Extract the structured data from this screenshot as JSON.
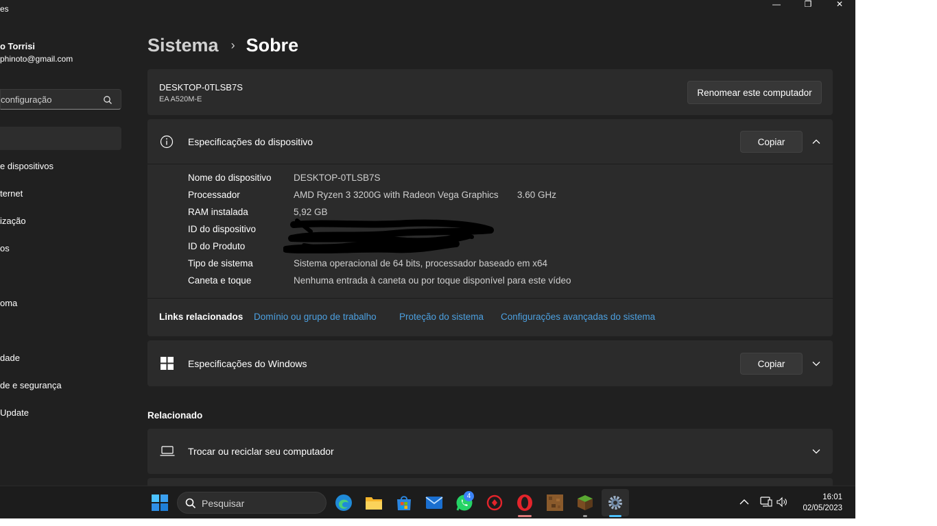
{
  "window": {
    "title_fragment": "es",
    "minimize_glyph": "—",
    "restore_glyph": "❐",
    "close_glyph": "✕"
  },
  "sidebar": {
    "user_name": "o Torrisi",
    "user_email": "phinoto@gmail.com",
    "search_placeholder": "configuração",
    "items": [
      {
        "label": "e dispositivos"
      },
      {
        "label": "ternet"
      },
      {
        "label": "ização"
      },
      {
        "label": "os"
      },
      {
        "label": "oma"
      },
      {
        "label": "dade"
      },
      {
        "label": "de e segurança"
      },
      {
        "label": " Update"
      }
    ]
  },
  "breadcrumb": {
    "parent": "Sistema",
    "separator": "›",
    "current": "Sobre"
  },
  "device": {
    "name": "DESKTOP-0TLSB7S",
    "model": "EA A520M-E",
    "rename_button": "Renomear este computador"
  },
  "device_specs": {
    "title": "Especificações do dispositivo",
    "copy_button": "Copiar",
    "rows": [
      {
        "label": "Nome do dispositivo",
        "value": "DESKTOP-0TLSB7S"
      },
      {
        "label": "Processador",
        "value": "AMD Ryzen 3 3200G with Radeon Vega Graphics",
        "extra": "3.60 GHz"
      },
      {
        "label": "RAM instalada",
        "value": "5,92 GB"
      },
      {
        "label": "ID do dispositivo",
        "value": ""
      },
      {
        "label": "ID do Produto",
        "value": ""
      },
      {
        "label": "Tipo de sistema",
        "value": "Sistema operacional de 64 bits, processador baseado em x64"
      },
      {
        "label": "Caneta e toque",
        "value": "Nenhuma entrada à caneta ou por toque disponível para este vídeo"
      }
    ],
    "links_label": "Links relacionados",
    "links": [
      "Domínio ou grupo de trabalho",
      "Proteção do sistema",
      "Configurações avançadas do sistema"
    ]
  },
  "windows_specs": {
    "title": "Especificações do Windows",
    "copy_button": "Copiar"
  },
  "related": {
    "heading": "Relacionado",
    "items": [
      {
        "label": "Trocar ou reciclar seu computador"
      }
    ]
  },
  "taskbar": {
    "search_label": "Pesquisar",
    "whatsapp_badge": "4",
    "time": "16:01",
    "date": "02/05/2023"
  },
  "colors": {
    "background": "#202020",
    "card": "#2b2b2b",
    "link": "#4ca0e0",
    "accent": "#0078d4"
  }
}
